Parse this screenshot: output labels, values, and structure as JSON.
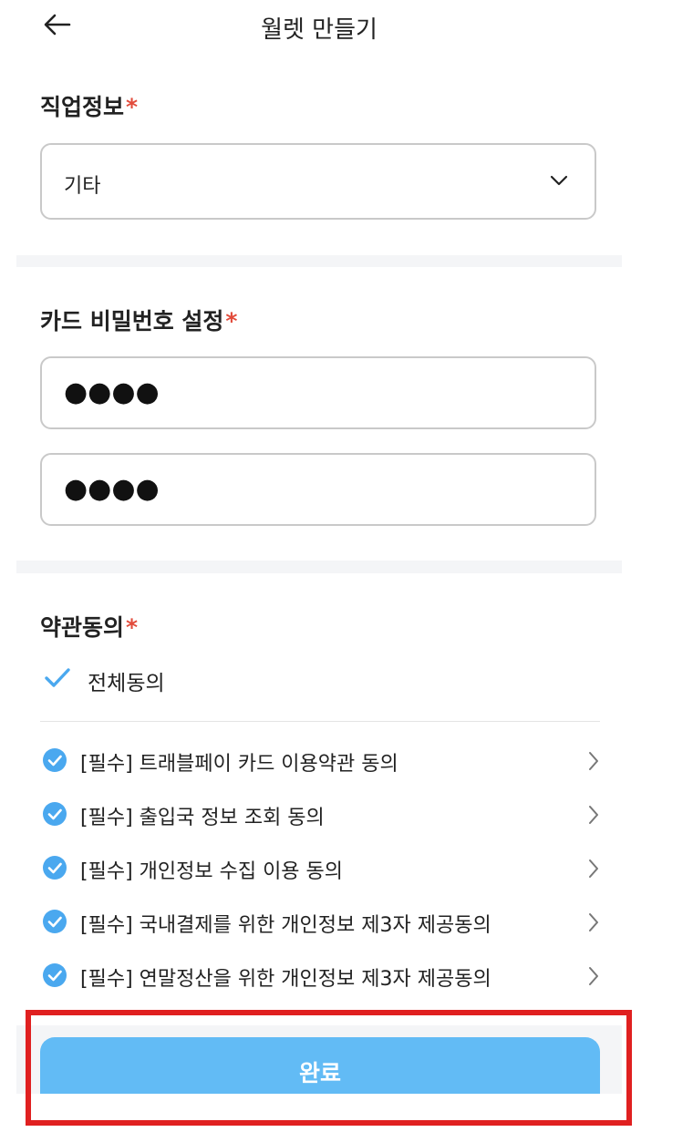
{
  "header": {
    "title": "월렛 만들기",
    "back_icon": "arrow-left-icon"
  },
  "job": {
    "label": "직업정보",
    "required_mark": "*",
    "selected_value": "기타",
    "dropdown_icon": "chevron-down-icon"
  },
  "password": {
    "label": "카드 비밀번호 설정",
    "required_mark": "*",
    "field1_value": "●●●●",
    "field2_value": "●●●●"
  },
  "terms": {
    "label": "약관동의",
    "required_mark": "*",
    "all_agree_label": "전체동의",
    "items": [
      {
        "label": "[필수] 트래블페이 카드 이용약관 동의",
        "checked": true
      },
      {
        "label": "[필수] 출입국 정보 조회 동의",
        "checked": true
      },
      {
        "label": "[필수] 개인정보 수집 이용 동의",
        "checked": true
      },
      {
        "label": "[필수] 국내결제를 위한 개인정보 제3자 제공동의",
        "checked": true
      },
      {
        "label": "[필수] 연말정산을 위한 개인정보 제3자 제공동의",
        "checked": true
      }
    ]
  },
  "footer": {
    "done_label": "완료"
  },
  "colors": {
    "accent": "#62bbf5",
    "check": "#4aa8ef",
    "required": "#e24b3b",
    "highlight": "#e02020"
  }
}
